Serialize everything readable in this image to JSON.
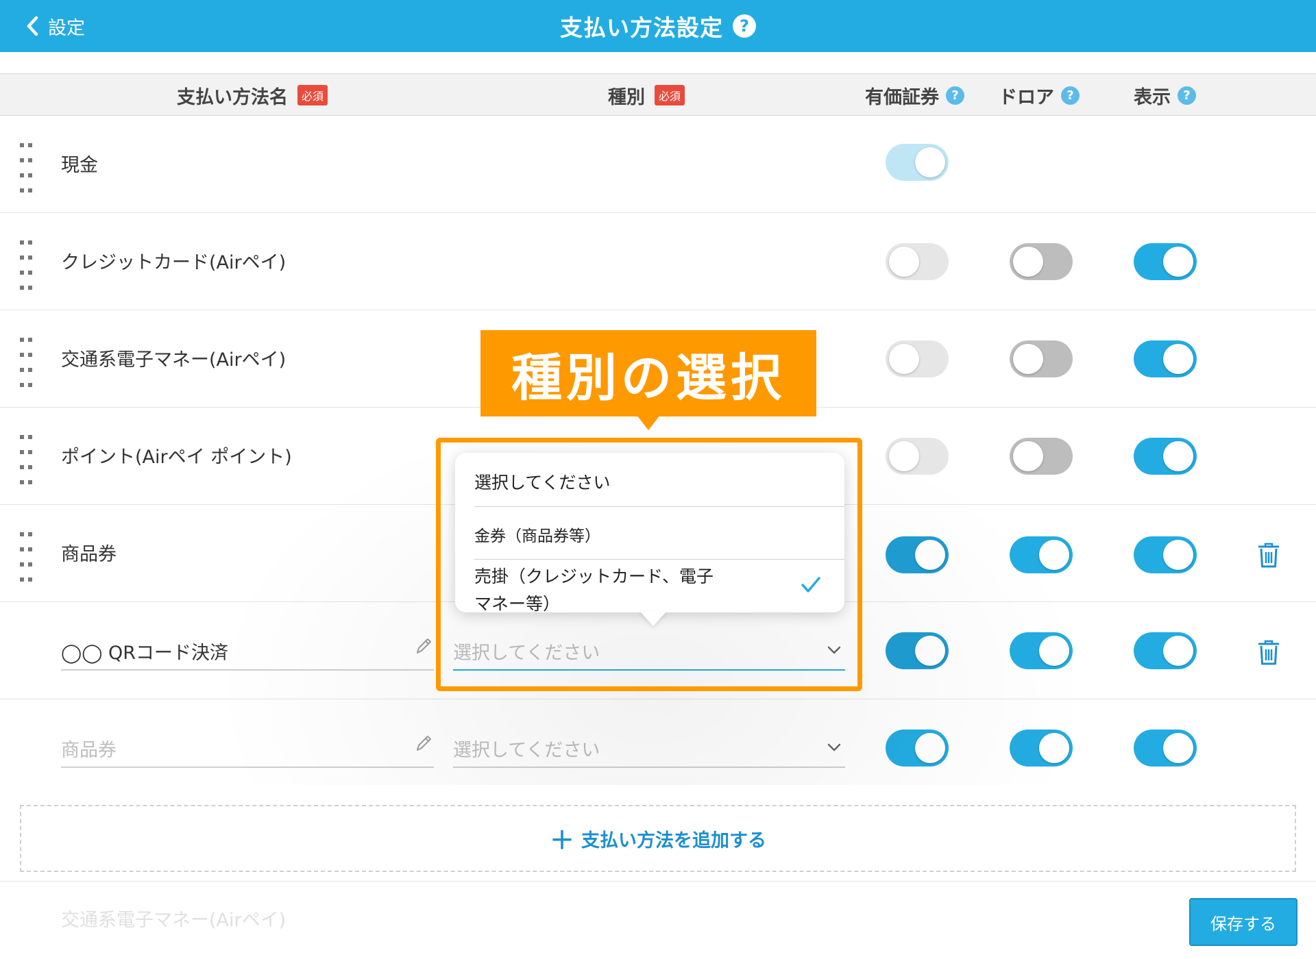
{
  "header": {
    "back_label": "設定",
    "title": "支払い方法設定",
    "help": "?"
  },
  "columns": {
    "name": "支払い方法名",
    "type": "種別",
    "required_badge": "必須",
    "securities": "有価証券",
    "drawer": "ドロア",
    "display": "表示",
    "help": "?"
  },
  "rows": [
    {
      "name": "現金",
      "securities": true,
      "drawer": null,
      "display": null,
      "deletable": false
    },
    {
      "name": "クレジットカード(Airペイ)",
      "securities": false,
      "drawer": false,
      "display": true,
      "deletable": false
    },
    {
      "name": "交通系電子マネー(Airペイ)",
      "securities": false,
      "drawer": false,
      "display": true,
      "deletable": false
    },
    {
      "name": "ポイント(Airペイ ポイント)",
      "securities": false,
      "drawer": false,
      "display": true,
      "deletable": false
    },
    {
      "name": "商品券",
      "securities": true,
      "drawer": true,
      "display": true,
      "deletable": true
    },
    {
      "name": "◯◯ QRコード決済",
      "type_placeholder": "選択してください",
      "securities": true,
      "drawer": true,
      "display": true,
      "deletable": true
    },
    {
      "name_placeholder": "商品券",
      "type_placeholder": "選択してください",
      "securities": true,
      "drawer": true,
      "display": true,
      "deletable": false
    }
  ],
  "dropdown": {
    "options": [
      "選択してください",
      "金券（商品券等）",
      "売掛（クレジットカード、電子",
      "マネー等）"
    ],
    "selected_index": 2
  },
  "callout": {
    "text": "種別の選択",
    "color": "#ff9900"
  },
  "add_button": {
    "plus": "＋",
    "label": "支払い方法を追加する"
  },
  "footer": {
    "ghost_row": "交通系電子マネー(Airペイ)",
    "save_label": "保存する"
  },
  "colors": {
    "brand": "#23ace2",
    "required": "#e84b3c"
  }
}
